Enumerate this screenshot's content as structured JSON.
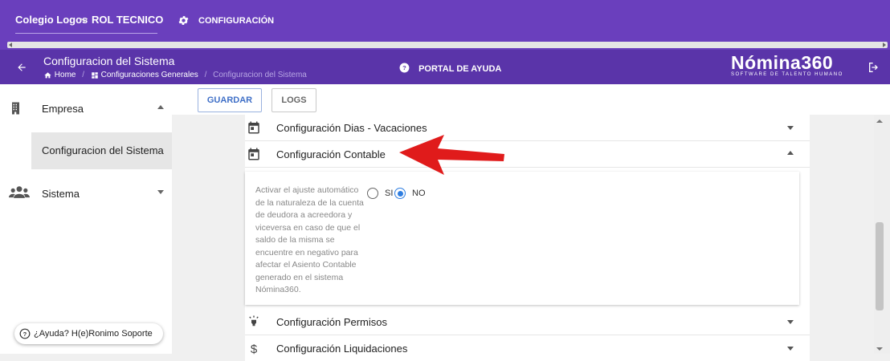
{
  "topbar": {
    "school": "Colegio Logos",
    "role": "ROL TECNICO",
    "config_label": "CONFIGURACIÓN"
  },
  "subbar": {
    "page_title": "Configuracion del Sistema",
    "breadcrumb": [
      "Home",
      "Configuraciones Generales",
      "Configuracion del Sistema"
    ],
    "portal_label": "PORTAL DE AYUDA",
    "brand_name": "Nómina360",
    "brand_tagline": "SOFTWARE DE TALENTO HUMANO"
  },
  "sidebar": {
    "items": [
      {
        "label": "Empresa"
      },
      {
        "label": "Configuracion del Sistema"
      },
      {
        "label": "Sistema"
      }
    ],
    "help_label": "¿Ayuda? H(e)Ronimo Soporte"
  },
  "toolbar": {
    "save_label": "GUARDAR",
    "logs_label": "LOGS"
  },
  "sections": [
    {
      "label": "Configuración Dias - Vacaciones"
    },
    {
      "label": "Configuración Contable"
    },
    {
      "label": "Configuración Permisos"
    },
    {
      "label": "Configuración Liquidaciones"
    }
  ],
  "contable": {
    "description": "Activar el ajuste automático de la naturaleza de la cuenta de deudora a acreedora y viceversa en caso de que el saldo de la misma se encuentre en negativo para afectar el Asiento Contable generado en el sistema Nómina360.",
    "option_yes": "SI",
    "option_no": "NO",
    "selected": "NO"
  },
  "colors": {
    "header": "#6a3fbd",
    "subheader": "#5a34a9",
    "primary": "#3f6fc7",
    "annotation_arrow": "#e01b1b"
  }
}
